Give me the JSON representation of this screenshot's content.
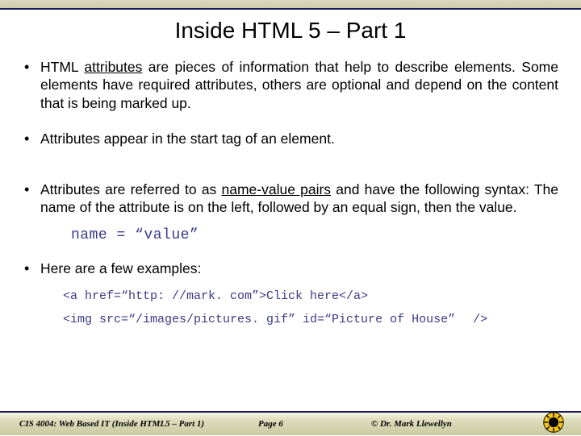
{
  "title": "Inside HTML 5 – Part 1",
  "bullets": {
    "b1a": "HTML ",
    "b1u": "attributes",
    "b1b": " are pieces of information that help to describe elements.  Some elements have required attributes, others are optional and depend on the content that is being marked up.",
    "b2": "Attributes appear in the start tag of an element.",
    "b3a": "Attributes are referred to as ",
    "b3u": "name-value pairs",
    "b3b": " and have the following syntax:  The name of the attribute is on the left, followed by an equal sign, then the value.",
    "b4": "Here are a few examples:"
  },
  "code": {
    "syntax": "name = “value”",
    "ex1": "<a href=“http: //mark. com”>Click here</a>",
    "ex2a": "<img src=“/images/pictures. gif” id=“Picture of House”",
    "ex2b": "/>"
  },
  "footer": {
    "left": "CIS 4004: Web Based IT (Inside HTML5 – Part 1)",
    "center": "Page 6",
    "right": "© Dr. Mark Llewellyn"
  }
}
